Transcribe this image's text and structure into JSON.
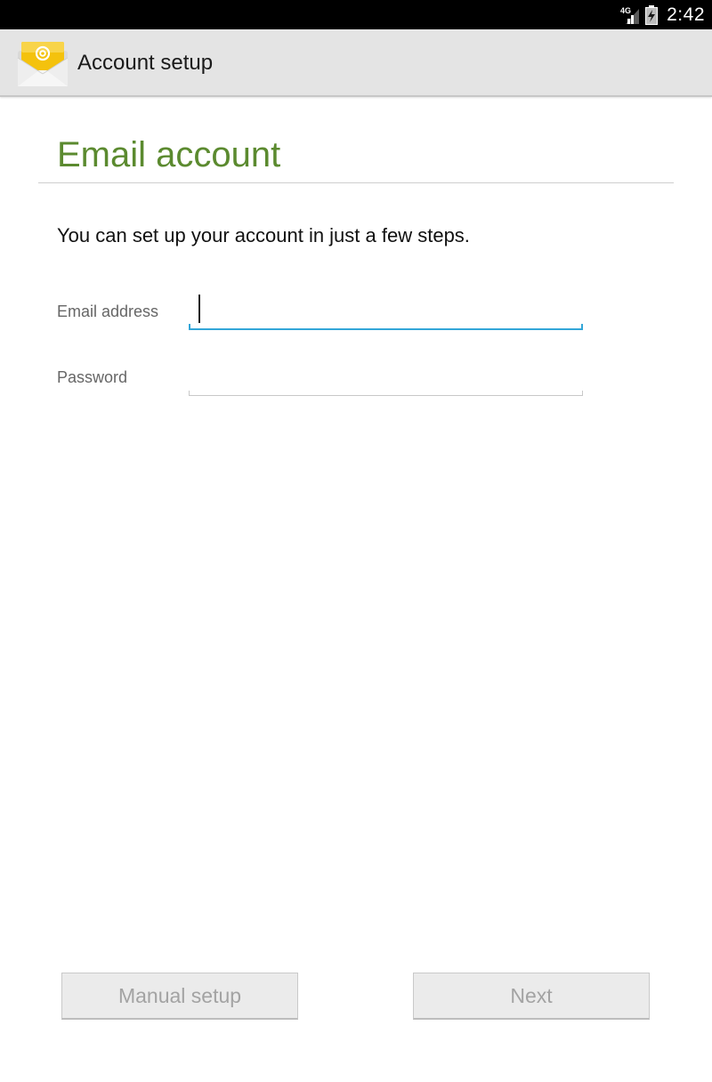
{
  "status_bar": {
    "network_label": "4G",
    "time": "2:42"
  },
  "action_bar": {
    "title": "Account setup",
    "app_icon": "email-app-icon"
  },
  "content": {
    "heading": "Email account",
    "intro": "You can set up your account in just a few steps.",
    "email": {
      "label": "Email address",
      "value": "",
      "placeholder": ""
    },
    "password": {
      "label": "Password",
      "value": "",
      "placeholder": ""
    }
  },
  "buttons": {
    "manual_setup": "Manual setup",
    "next": "Next"
  },
  "colors": {
    "accent_green": "#5b8a2f",
    "focus_blue": "#33a6d8",
    "status_bar": "#000000",
    "action_bar": "#e4e4e4"
  }
}
